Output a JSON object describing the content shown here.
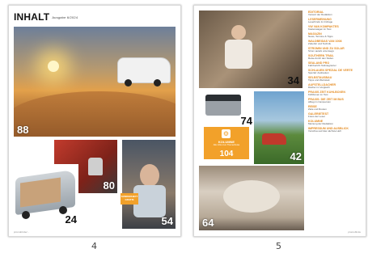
{
  "spread": {
    "left_page_number": "4",
    "right_page_number": "5"
  },
  "page4": {
    "title": "INHALT",
    "issue": "Ausgabe 6/2024",
    "hero_number": "88",
    "numbers": [
      "80",
      "24",
      "54"
    ],
    "callout": "SONDERHEFT GRATIS",
    "footer": "promobil.de/..."
  },
  "page5": {
    "numbers": [
      "34",
      "74",
      "42",
      "64"
    ],
    "kolumne": {
      "label": "KOLUMNE",
      "subtitle": "Alle Infos zum Thema Reise",
      "number": "104"
    },
    "toc": [
      {
        "h": "EDITORIAL",
        "t": "Vorwort der Redaktion"
      },
      {
        "h": "LESERMEINUNG",
        "t": "Leserbriefe & Umfrage"
      },
      {
        "h": "VW VAN KOMPAKTES",
        "t": "Kastenwagen im Test"
      },
      {
        "h": "MAGAZIN",
        "t": "News, Termine & Tipps"
      },
      {
        "h": "WALDBEIDAS VAN 1008",
        "t": "Zubehör und Technik"
      },
      {
        "h": "STROMIN UND ZU SOLAR",
        "t": "Strom autark unterwegs"
      },
      {
        "h": "SOUTHERN TRAIL",
        "t": "Reise durch den Süden"
      },
      {
        "h": "SEALAND PRO",
        "t": "Fahrbericht Teilintegrierter"
      },
      {
        "h": "SCHLAUEN SPEZIAL DE VERTE",
        "t": "Spezial: Ausbauten"
      },
      {
        "h": "SELBSTAUSBAU",
        "t": "Tipps und Werkstatt"
      },
      {
        "h": "AUFSTELLDACHER",
        "t": "Dächer im Vergleich"
      },
      {
        "h": "PRAXIS ZEIT KUHLBOXEN",
        "t": "Kühlboxen im Test"
      },
      {
        "h": "PRAXIS: DIE ZEIT IM BUS",
        "t": "Alltag im Campervan"
      },
      {
        "h": "REISE",
        "t": "Ziele und Routen"
      },
      {
        "h": "GALERIETEST",
        "t": "Fotos der Leser"
      },
      {
        "h": "KOLUMNE",
        "t": "Meinung der Redaktion"
      },
      {
        "h": "IMPRESSUM UND AUSBLICK",
        "t": "Vorschau auf das nächste Heft"
      }
    ],
    "footer": "promobil.de"
  },
  "colors": {
    "accent": "#f2a12a",
    "toc_head": "#e48a1e"
  }
}
